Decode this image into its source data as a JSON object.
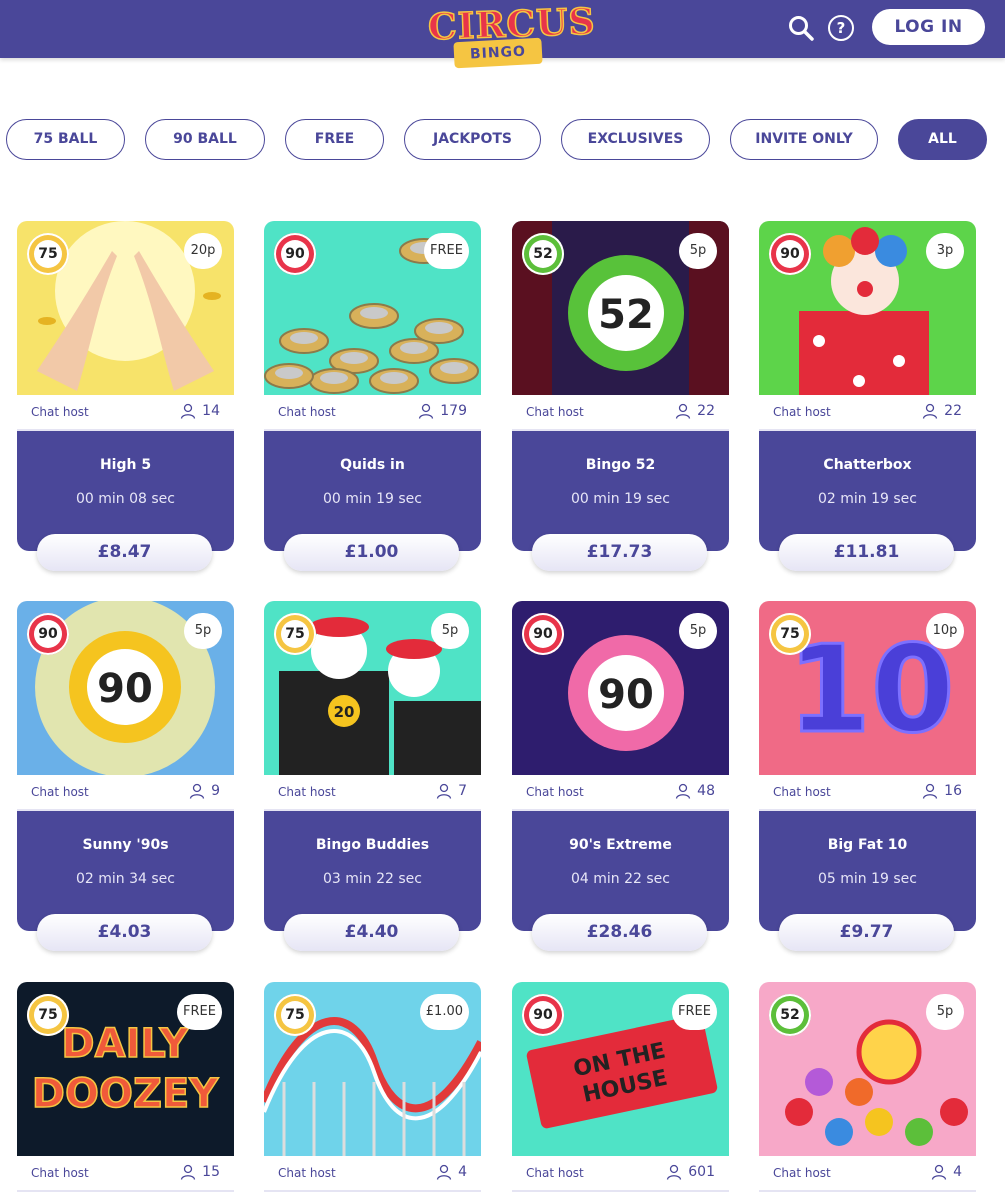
{
  "header": {
    "logo_top": "CIRCUS",
    "logo_bottom": "BINGO",
    "login_label": "LOG IN",
    "icons": [
      "search-icon",
      "help-icon"
    ]
  },
  "filters": [
    {
      "label": "75 BALL",
      "active": false
    },
    {
      "label": "90 BALL",
      "active": false
    },
    {
      "label": "FREE",
      "active": false
    },
    {
      "label": "JACKPOTS",
      "active": false
    },
    {
      "label": "EXCLUSIVES",
      "active": false
    },
    {
      "label": "INVITE ONLY",
      "active": false
    },
    {
      "label": "ALL",
      "active": true
    }
  ],
  "colors": {
    "brand": "#4a4799",
    "ball75": "#f5c542",
    "ball90": "#e8344a",
    "ball52": "#5cbf3a"
  },
  "rooms": [
    {
      "ball": "75",
      "price": "20p",
      "host": "Chat host",
      "players": "14",
      "name": "High 5",
      "timer": "00 min 08 sec",
      "jackpot": "£8.47",
      "art": "hands-icon"
    },
    {
      "ball": "90",
      "price": "FREE",
      "host": "Chat host",
      "players": "179",
      "name": "Quids in",
      "timer": "00 min 19 sec",
      "jackpot": "£1.00",
      "art": "coins-icon"
    },
    {
      "ball": "52",
      "price": "5p",
      "host": "Chat host",
      "players": "22",
      "name": "Bingo 52",
      "timer": "00 min 19 sec",
      "jackpot": "£17.73",
      "art": "ball-52-icon"
    },
    {
      "ball": "90",
      "price": "3p",
      "host": "Chat host",
      "players": "22",
      "name": "Chatterbox",
      "timer": "02 min 19 sec",
      "jackpot": "£11.81",
      "art": "clown-icon"
    },
    {
      "ball": "90",
      "price": "5p",
      "host": "Chat host",
      "players": "9",
      "name": "Sunny '90s",
      "timer": "02 min 34 sec",
      "jackpot": "£4.03",
      "art": "ball-90-sun-icon"
    },
    {
      "ball": "75",
      "price": "5p",
      "host": "Chat host",
      "players": "7",
      "name": "Bingo Buddies",
      "timer": "03 min 22 sec",
      "jackpot": "£4.40",
      "art": "mimes-icon"
    },
    {
      "ball": "90",
      "price": "5p",
      "host": "Chat host",
      "players": "48",
      "name": "90's Extreme",
      "timer": "04 min 22 sec",
      "jackpot": "£28.46",
      "art": "ball-90-pink-icon"
    },
    {
      "ball": "75",
      "price": "10p",
      "host": "Chat host",
      "players": "16",
      "name": "Big Fat 10",
      "timer": "05 min 19 sec",
      "jackpot": "£9.77",
      "art": "balloon-10-icon"
    },
    {
      "ball": "75",
      "price": "FREE",
      "host": "Chat host",
      "players": "15",
      "name": "",
      "timer": "",
      "jackpot": "",
      "art": "daily-doozey-icon",
      "art_text": [
        "DAILY",
        "DOOZEY"
      ]
    },
    {
      "ball": "75",
      "price": "£1.00",
      "host": "Chat host",
      "players": "4",
      "name": "",
      "timer": "",
      "jackpot": "",
      "art": "rollercoaster-icon"
    },
    {
      "ball": "90",
      "price": "FREE",
      "host": "Chat host",
      "players": "601",
      "name": "",
      "timer": "",
      "jackpot": "",
      "art": "tickets-icon",
      "art_text": [
        "ON THE",
        "HOUSE"
      ]
    },
    {
      "ball": "52",
      "price": "5p",
      "host": "Chat host",
      "players": "4",
      "name": "",
      "timer": "",
      "jackpot": "",
      "art": "candy-icon"
    }
  ]
}
